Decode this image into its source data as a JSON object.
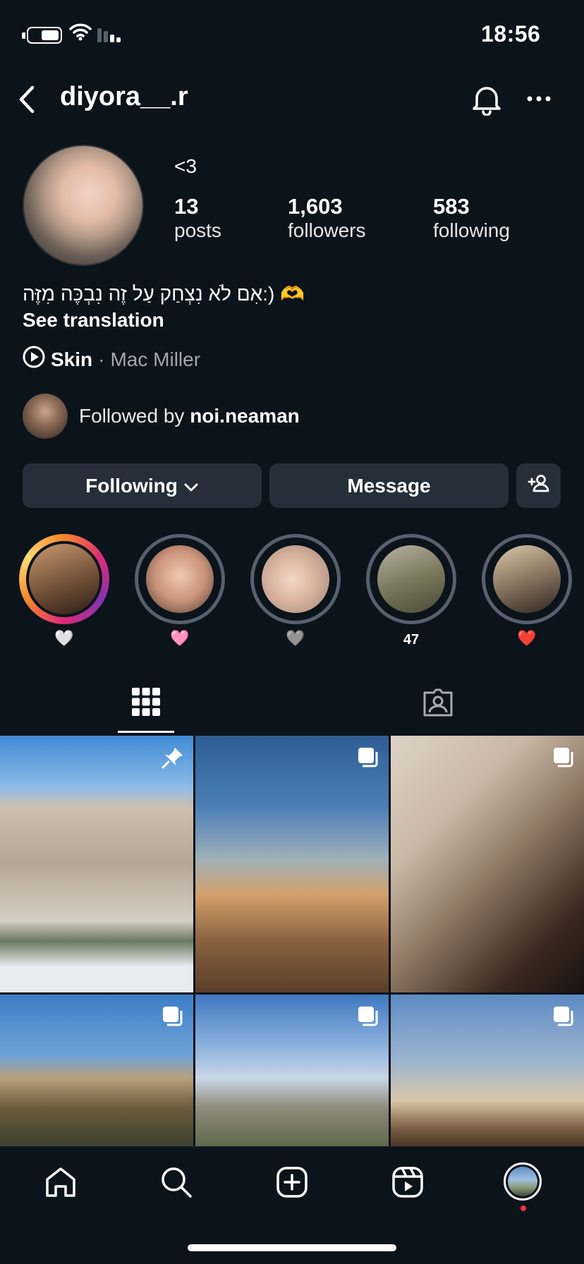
{
  "status_bar": {
    "time": "18:56"
  },
  "header": {
    "username": "diyora__.r"
  },
  "profile": {
    "display_name": "<3",
    "stats": [
      {
        "value": "13",
        "label": "posts"
      },
      {
        "value": "1,603",
        "label": "followers"
      },
      {
        "value": "583",
        "label": "following"
      }
    ],
    "bio": "אִם לֹא נִצְחַק עַל זֶה נִבְכֶּה מִזֶּה:) 🫶",
    "see_translation": "See translation",
    "music": {
      "song": "Skin",
      "separator": "·",
      "artist": "Mac Miller"
    },
    "followed_by_prefix": "Followed by ",
    "followed_by_user": "noi.neaman"
  },
  "actions": {
    "following_label": "Following",
    "message_label": "Message"
  },
  "highlights": [
    {
      "label": "🤍",
      "ring": "gradient"
    },
    {
      "label": "🩷",
      "ring": "gray"
    },
    {
      "label": "🩶",
      "ring": "gray"
    },
    {
      "label": "47",
      "ring": "gray"
    },
    {
      "label": "❤️",
      "ring": "gray"
    }
  ],
  "tabs": [
    "grid-icon",
    "tagged-icon"
  ],
  "grid": [
    {
      "badge": "pin-icon"
    },
    {
      "badge": "carousel-icon"
    },
    {
      "badge": "carousel-icon"
    },
    {
      "badge": "carousel-icon"
    },
    {
      "badge": "carousel-icon"
    },
    {
      "badge": "carousel-icon"
    }
  ],
  "nav": [
    "home-icon",
    "search-icon",
    "create-icon",
    "reels-icon",
    "profile-avatar"
  ],
  "colors": {
    "background": "#0b131b",
    "button": "#262f39",
    "notification_dot": "#ff3040"
  }
}
